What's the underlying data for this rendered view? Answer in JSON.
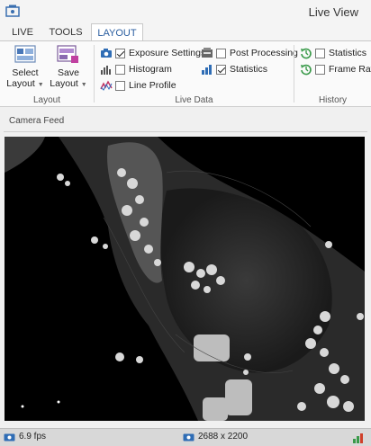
{
  "window": {
    "title": "Live View"
  },
  "tabs": [
    {
      "label": "LIVE",
      "active": false
    },
    {
      "label": "TOOLS",
      "active": false
    },
    {
      "label": "LAYOUT",
      "active": true
    }
  ],
  "ribbon": {
    "layout_group": {
      "label": "Layout",
      "select_layout": {
        "line1": "Select",
        "line2": "Layout"
      },
      "save_layout": {
        "line1": "Save",
        "line2": "Layout"
      }
    },
    "live_data_group": {
      "label": "Live Data",
      "options": [
        {
          "label": "Exposure Settings",
          "checked": true,
          "icon": "camera-icon"
        },
        {
          "label": "Histogram",
          "checked": false,
          "icon": "histogram-icon"
        },
        {
          "label": "Line Profile",
          "checked": false,
          "icon": "line-profile-icon"
        },
        {
          "label": "Post Processing",
          "checked": false,
          "icon": "processing-icon"
        },
        {
          "label": "Statistics",
          "checked": true,
          "icon": "bar-chart-icon"
        }
      ]
    },
    "history_group": {
      "label": "History",
      "options": [
        {
          "label": "Statistics",
          "checked": false,
          "icon": "history-icon"
        },
        {
          "label": "Frame Rate",
          "checked": false,
          "icon": "history-icon"
        }
      ]
    }
  },
  "panel": {
    "title": "Camera Feed"
  },
  "status": {
    "fps": "6.9 fps",
    "resolution": "2688 x 2200"
  },
  "colors": {
    "accent": "#2a5ea0",
    "tab_active_text": "#2a5ea0"
  }
}
